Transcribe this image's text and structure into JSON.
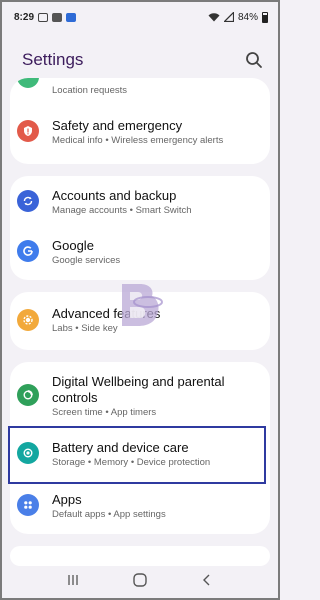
{
  "status_bar": {
    "time": "8:29",
    "battery": "84%"
  },
  "header": {
    "title": "Settings"
  },
  "settings_items": [
    {
      "title": "",
      "subtitle": "Location requests",
      "icon": "location-icon",
      "color": "#3fba7a"
    },
    {
      "title": "Safety and emergency",
      "subtitle": "Medical info  •  Wireless emergency alerts",
      "icon": "safety-icon",
      "color": "#e25a4a"
    },
    {
      "title": "Accounts and backup",
      "subtitle": "Manage accounts  •  Smart Switch",
      "icon": "sync-icon",
      "color": "#3a63d8"
    },
    {
      "title": "Google",
      "subtitle": "Google services",
      "icon": "google-icon",
      "color": "#3f7cec"
    },
    {
      "title": "Advanced features",
      "subtitle": "Labs  •  Side key",
      "icon": "advanced-features-icon",
      "color": "#f2a93b"
    },
    {
      "title": "Digital Wellbeing and parental controls",
      "subtitle": "Screen time  •  App timers",
      "icon": "wellbeing-icon",
      "color": "#2fa05a"
    },
    {
      "title": "Battery and device care",
      "subtitle": "Storage  •  Memory  •  Device protection",
      "icon": "device-care-icon",
      "color": "#13a7a0"
    },
    {
      "title": "Apps",
      "subtitle": "Default apps  •  App settings",
      "icon": "apps-icon",
      "color": "#4a7fe8"
    }
  ],
  "colors": {
    "background": "#f3f1f6",
    "title": "#3c1c5c",
    "highlight": "#2f3aa0"
  }
}
